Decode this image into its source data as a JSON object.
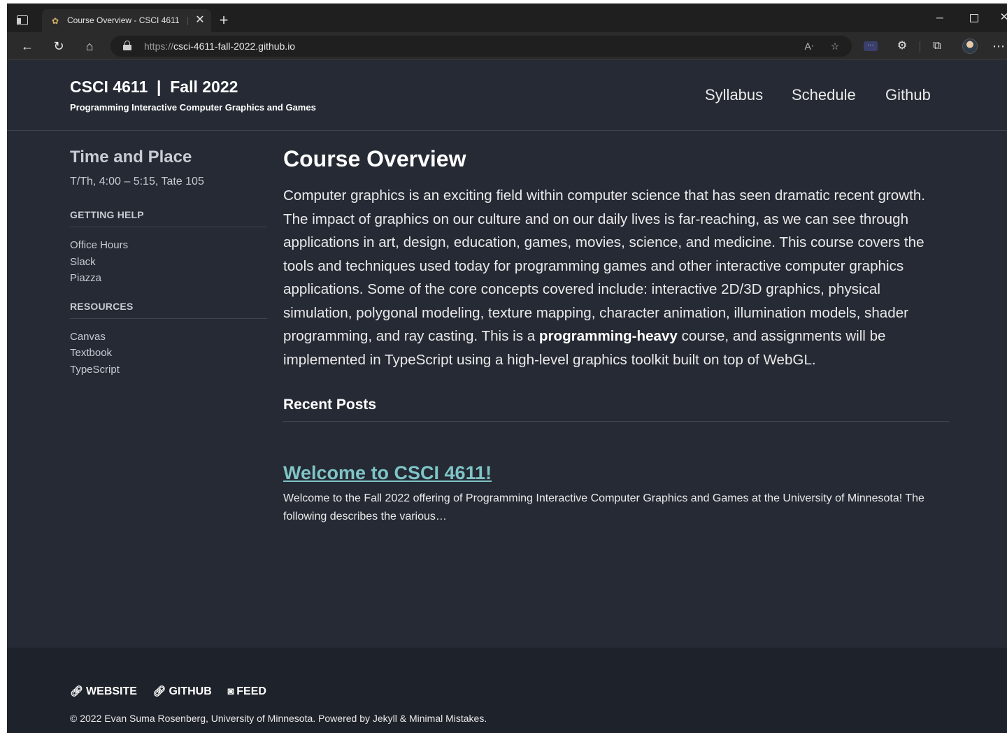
{
  "browser": {
    "tab_title": "Course Overview - CSCI 4611",
    "url_scheme": "https://",
    "url_host": "csci-4611-fall-2022.github.io",
    "icons": [
      "tab-actions-icon",
      "favicon-icon",
      "close-icon",
      "plus-icon",
      "back-icon",
      "refresh-icon",
      "home-icon",
      "lock-icon",
      "read-aloud-icon",
      "favorite-icon",
      "extension-icon",
      "puzzle-icon",
      "collections-icon",
      "profile-avatar",
      "more-icon"
    ]
  },
  "site": {
    "title": "CSCI 4611  |  Fall 2022",
    "subtitle": "Programming Interactive Computer Graphics and Games"
  },
  "nav": [
    "Syllabus",
    "Schedule",
    "Github"
  ],
  "sidebar": {
    "heading": "Time and Place",
    "time": "T/Th, 4:00 – 5:15, Tate 105",
    "sections": [
      {
        "title": "GETTING HELP",
        "links": [
          "Office Hours",
          "Slack",
          "Piazza"
        ]
      },
      {
        "title": "RESOURCES",
        "links": [
          "Canvas",
          "Textbook",
          "TypeScript"
        ]
      }
    ]
  },
  "main": {
    "title": "Course Overview",
    "intro_before": "Computer graphics is an exciting field within computer science that has seen dramatic recent growth. The impact of graphics on our culture and on our daily lives is far-reaching, as we can see through applications in art, design, education, games, movies, science, and medicine. This course covers the tools and techniques used today for programming games and other interactive computer graphics applications. Some of the core concepts covered include: interactive 2D/3D graphics, physical simulation, polygonal modeling, texture mapping, character animation, illumination models, shader programming, and ray casting. This is a ",
    "intro_bold": "programming-heavy",
    "intro_after": " course, and assignments will be implemented in TypeScript using a high-level graphics toolkit built on top of WebGL.",
    "recent_heading": "Recent Posts",
    "post_title": "Welcome to CSCI 4611!",
    "post_excerpt": "Welcome to the Fall 2022 offering of Programming Interactive Computer Graphics and Games at the University of Minnesota! The following describes the various…"
  },
  "footer": {
    "links": [
      {
        "label": "WEBSITE",
        "icon": "link-icon"
      },
      {
        "label": "GITHUB",
        "icon": "link-icon"
      },
      {
        "label": "FEED",
        "icon": "rss-icon"
      }
    ],
    "copyright": "© 2022 Evan Suma Rosenberg, University of Minnesota. Powered by Jekyll & Minimal Mistakes."
  },
  "colors": {
    "page_bg": "#252a34",
    "footer_bg": "#1e222a",
    "link_accent": "#7fc4c6"
  }
}
